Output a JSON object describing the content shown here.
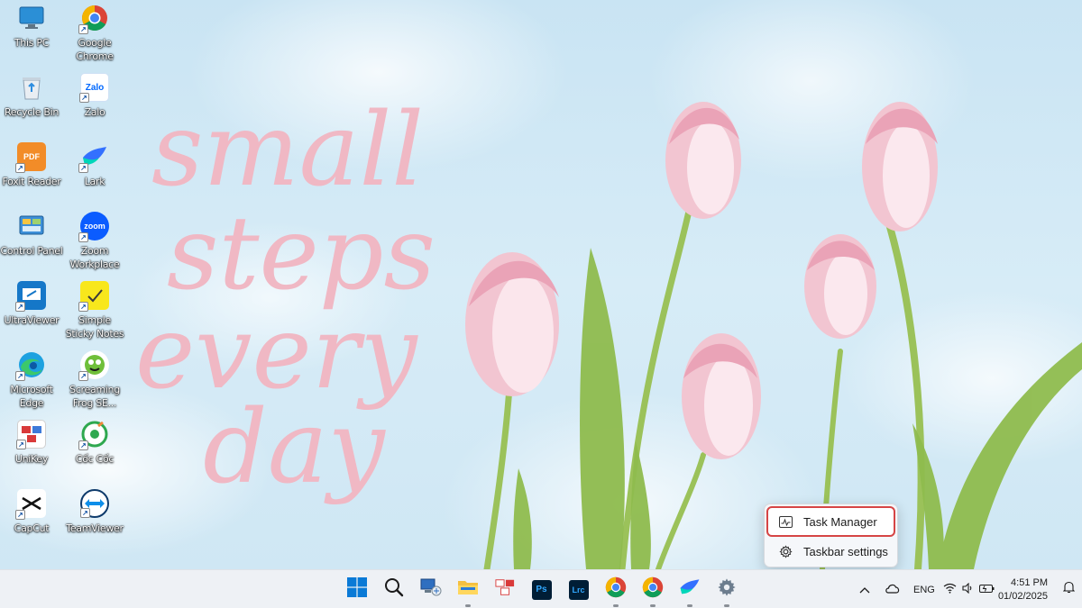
{
  "desktop": {
    "icons": [
      {
        "label": "This PC"
      },
      {
        "label": "Google Chrome"
      },
      {
        "label": "Recycle Bin"
      },
      {
        "label": "Zalo",
        "glyph": "Zalo"
      },
      {
        "label": "Foxit Reader",
        "glyph": "PDF"
      },
      {
        "label": "Lark"
      },
      {
        "label": "Control Panel"
      },
      {
        "label": "Zoom Workplace",
        "glyph": "zoom"
      },
      {
        "label": "UltraViewer"
      },
      {
        "label": "Simple Sticky Notes"
      },
      {
        "label": "Microsoft Edge"
      },
      {
        "label": "Screaming Frog SE..."
      },
      {
        "label": "UniKey"
      },
      {
        "label": "Cốc Cốc"
      },
      {
        "label": "CapCut"
      },
      {
        "label": "TeamViewer"
      }
    ]
  },
  "context_menu": {
    "items": [
      {
        "label": "Task Manager",
        "icon": "task-manager-icon"
      },
      {
        "label": "Taskbar settings",
        "icon": "gear-icon"
      }
    ]
  },
  "taskbar": {
    "apps": [
      {
        "name": "start",
        "icon": "windows-logo-icon"
      },
      {
        "name": "search",
        "icon": "search-icon"
      },
      {
        "name": "network-app",
        "icon": "network-computer-icon"
      },
      {
        "name": "file-explorer",
        "icon": "folder-icon"
      },
      {
        "name": "unikey",
        "icon": "unikey-icon"
      },
      {
        "name": "photoshop",
        "icon": "photoshop-icon",
        "glyph": "Ps"
      },
      {
        "name": "lightroom",
        "icon": "lightroom-icon",
        "glyph": "Lrc"
      },
      {
        "name": "chrome",
        "icon": "chrome-icon"
      },
      {
        "name": "chrome-2",
        "icon": "chrome-icon"
      },
      {
        "name": "lark",
        "icon": "lark-icon"
      },
      {
        "name": "settings",
        "icon": "settings-gear-icon"
      }
    ],
    "tray": {
      "language": "ENG",
      "time": "4:51 PM",
      "date": "01/02/2025"
    }
  },
  "wallpaper": {
    "lettering": [
      "small",
      "steps",
      "every",
      "day"
    ]
  },
  "colors": {
    "accent_red": "#d64545",
    "taskbar_bg": "#eef1f5",
    "lettering_pink": "#f0b8c4"
  }
}
